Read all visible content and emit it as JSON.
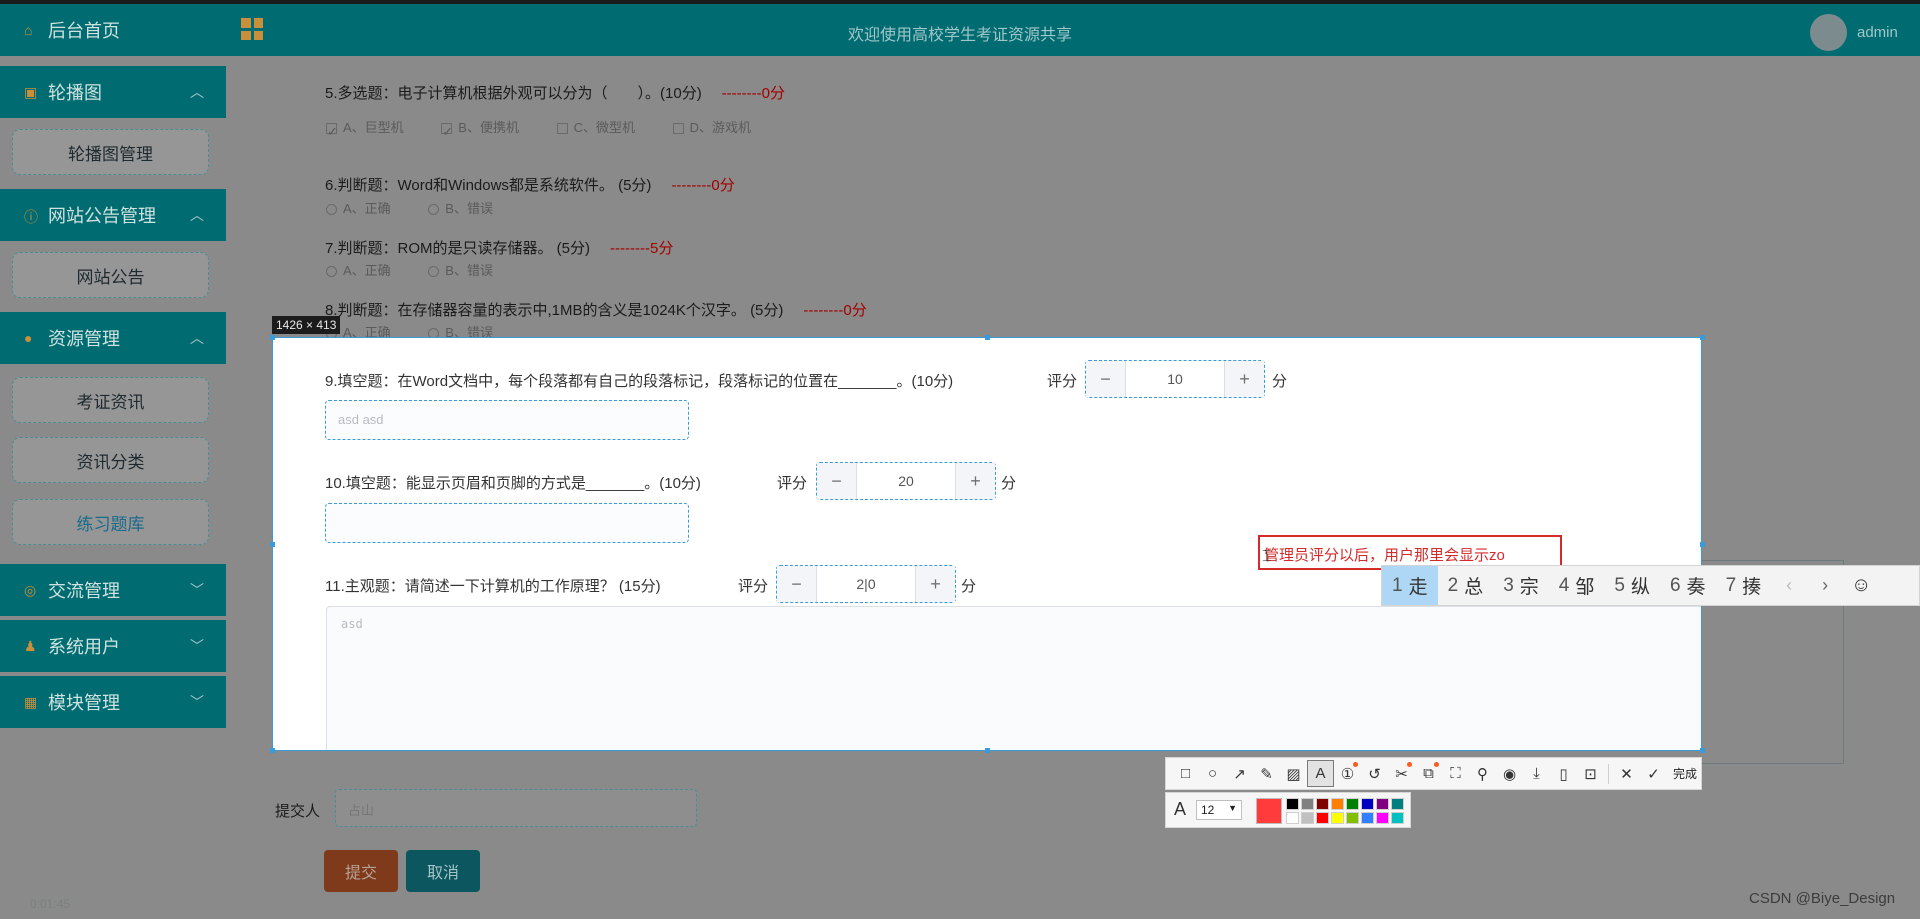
{
  "header": {
    "title": "欢迎使用高校学生考证资源共享",
    "user": "admin"
  },
  "sidebar": {
    "home": "后台首页",
    "sections": [
      {
        "label": "轮播图",
        "children": [
          "轮播图管理"
        ]
      },
      {
        "label": "网站公告管理",
        "children": [
          "网站公告"
        ]
      },
      {
        "label": "资源管理",
        "children": [
          "考证资讯",
          "资讯分类",
          "练习题库"
        ]
      },
      {
        "label": "交流管理"
      },
      {
        "label": "系统用户"
      },
      {
        "label": "模块管理"
      }
    ],
    "time": "0:01:45"
  },
  "background": {
    "q5": {
      "text": "5.多选题：电子计算机根据外观可以分为（　　）。(10分)",
      "score": "--------0分",
      "options": [
        "A、巨型机",
        "B、便携机",
        "C、微型机",
        "D、游戏机"
      ]
    },
    "q6": {
      "text": "6.判断题：Word和Windows都是系统软件。 (5分)",
      "score": "--------0分",
      "options": [
        "A、正确",
        "B、错误"
      ]
    },
    "q7": {
      "text": "7.判断题：ROM的是只读存储器。 (5分)",
      "score": "--------5分",
      "options": [
        "A、正确",
        "B、错误"
      ]
    },
    "q8": {
      "text": "8.判断题：在存储器容量的表示中,1MB的含义是1024K个汉字。 (5分)",
      "score": "--------0分",
      "options": [
        "A、正确",
        "B、错误"
      ]
    },
    "submitter_label": "提交人",
    "submitter_value": "占山",
    "submit": "提交",
    "cancel": "取消"
  },
  "capture": {
    "size_label": "1426 × 413",
    "q9": {
      "text": "9.填空题：在Word文档中，每个段落都有自己的段落标记，段落标记的位置在_______。(10分)",
      "score_label": "评分",
      "score": "10",
      "unit": "分",
      "answer": "asd asd"
    },
    "q10": {
      "text": "10.填空题：能显示页眉和页脚的方式是_______。(10分)",
      "score_label": "评分",
      "score": "20",
      "unit": "分",
      "answer": ""
    },
    "q11": {
      "text": "11.主观题：请简述一下计算机的工作原理？ (15分)",
      "score_label": "评分",
      "score": "2|0",
      "unit": "分",
      "answer": "asd"
    },
    "annotation": "管理员评分以后，用户那里会显示zo"
  },
  "ime": {
    "candidates": [
      {
        "n": "1",
        "c": "走"
      },
      {
        "n": "2",
        "c": "总"
      },
      {
        "n": "3",
        "c": "宗"
      },
      {
        "n": "4",
        "c": "邹"
      },
      {
        "n": "5",
        "c": "纵"
      },
      {
        "n": "6",
        "c": "奏"
      },
      {
        "n": "7",
        "c": "揍"
      }
    ],
    "prev": "‹",
    "next": "›",
    "emoji": "☺"
  },
  "toolbar": {
    "done": "完成",
    "font_size": "12",
    "current_color": "#ff3b3b",
    "palette": [
      "#000000",
      "#808080",
      "#800000",
      "#ff8000",
      "#008000",
      "#0000c0",
      "#800080",
      "#008080",
      "#ffffff",
      "#c0c0c0",
      "#ff0000",
      "#ffff00",
      "#80c000",
      "#3080ff",
      "#ff00ff",
      "#00c0c0"
    ]
  },
  "watermark": "CSDN @Biye_Design"
}
